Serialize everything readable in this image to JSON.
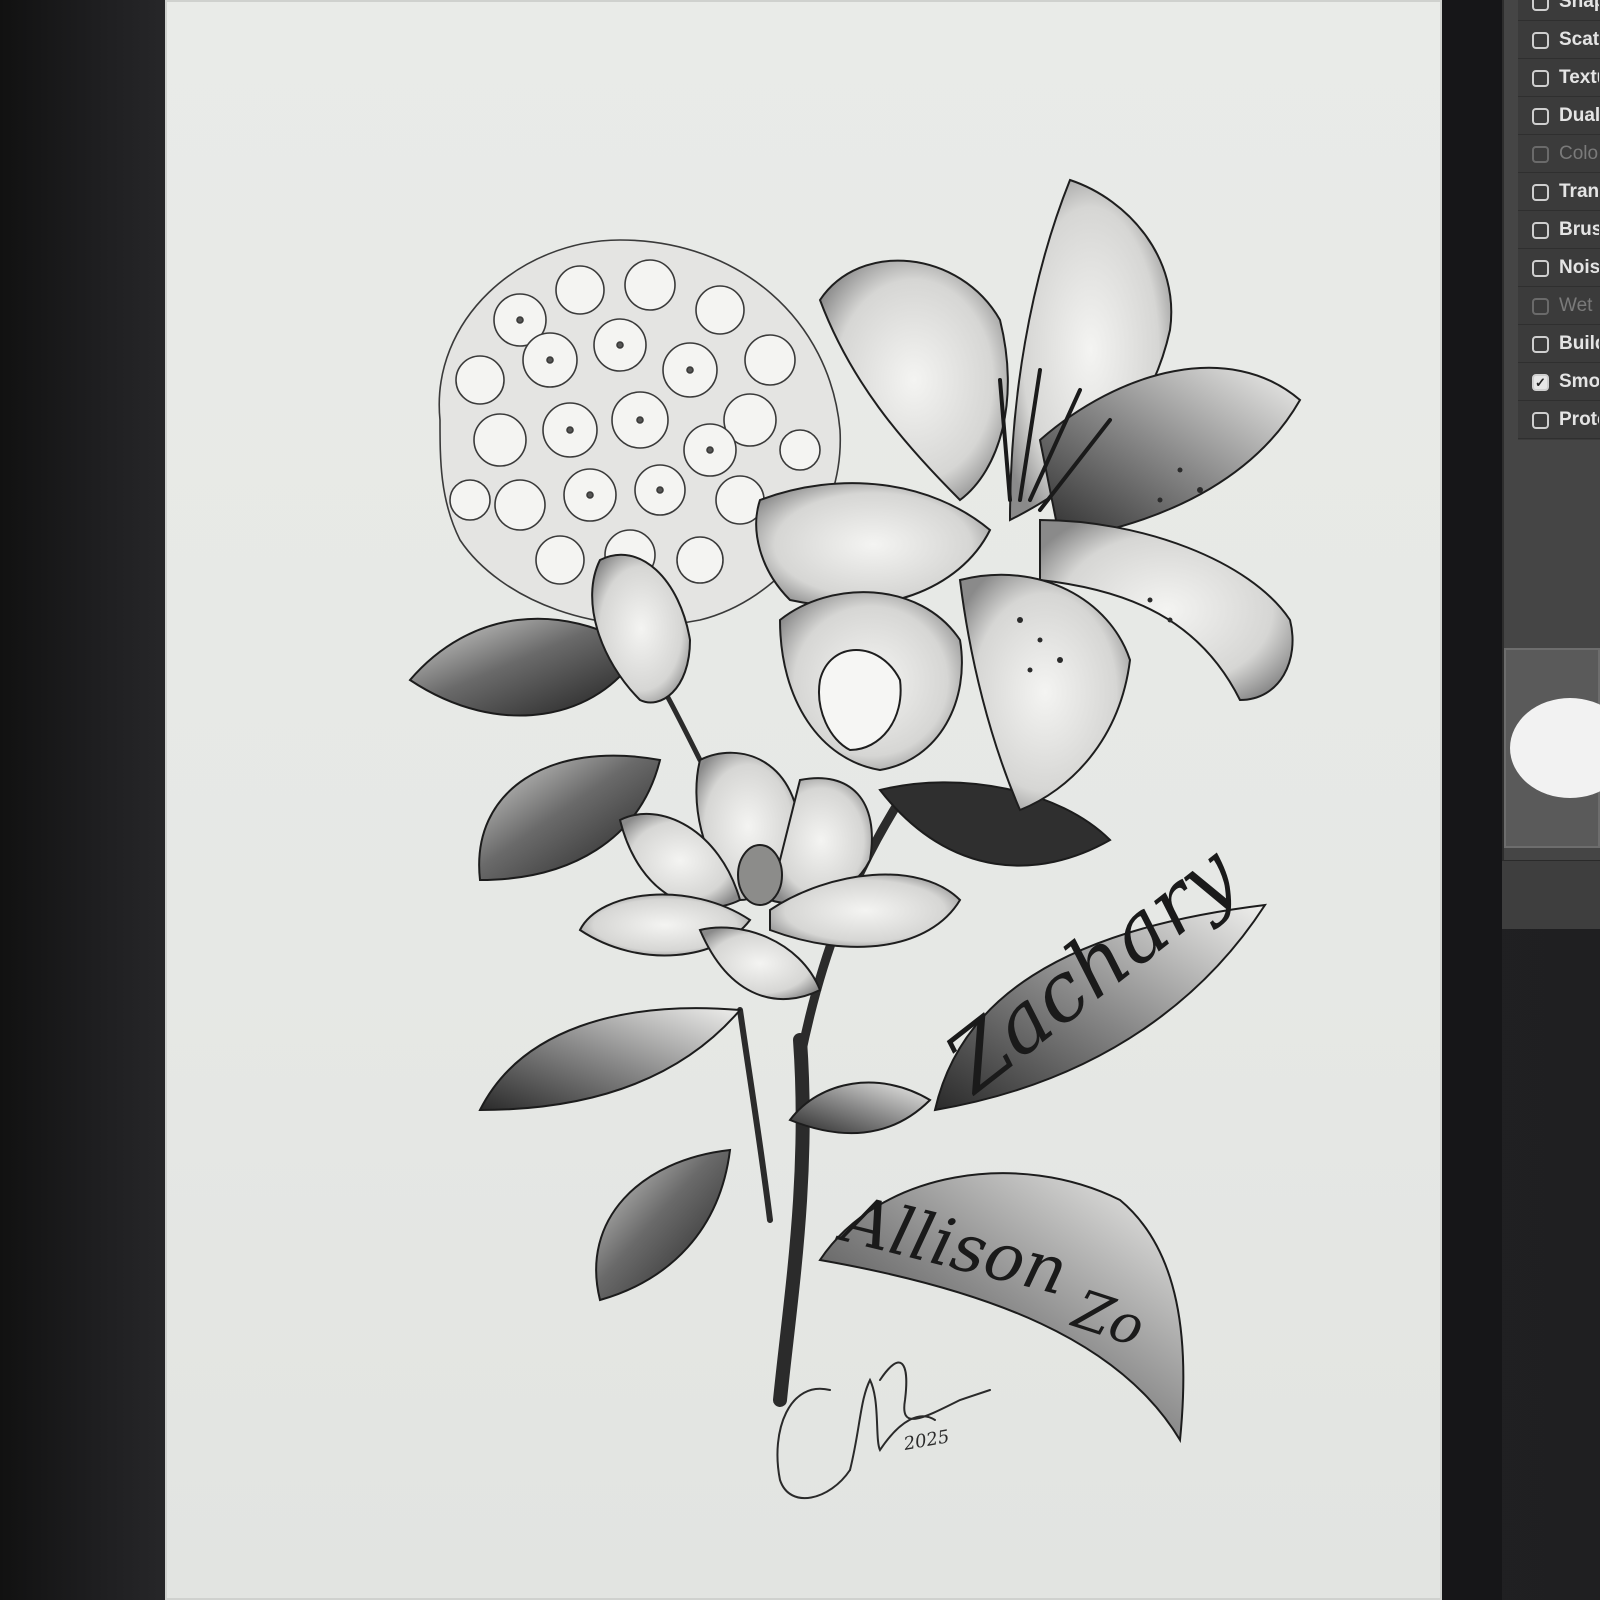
{
  "brush_settings_panel": {
    "options": [
      {
        "label": "Shape Dynamics",
        "checked": false,
        "enabled": true
      },
      {
        "label": "Scattering",
        "checked": false,
        "enabled": true
      },
      {
        "label": "Texture",
        "checked": false,
        "enabled": true
      },
      {
        "label": "Dual Brush",
        "checked": false,
        "enabled": true
      },
      {
        "label": "Color Dynamics",
        "checked": false,
        "enabled": false
      },
      {
        "label": "Transfer",
        "checked": false,
        "enabled": true
      },
      {
        "label": "Brush Pose",
        "checked": false,
        "enabled": true
      },
      {
        "label": "Noise",
        "checked": false,
        "enabled": true
      },
      {
        "label": "Wet Edges",
        "checked": false,
        "enabled": false
      },
      {
        "label": "Build-up",
        "checked": false,
        "enabled": true
      },
      {
        "label": "Smoothing",
        "checked": true,
        "enabled": true
      },
      {
        "label": "Protect Texture",
        "checked": false,
        "enabled": true
      }
    ]
  },
  "artwork": {
    "banner_names": [
      "Zachary",
      "Allison",
      "Zo"
    ],
    "signature_year": "2025"
  }
}
